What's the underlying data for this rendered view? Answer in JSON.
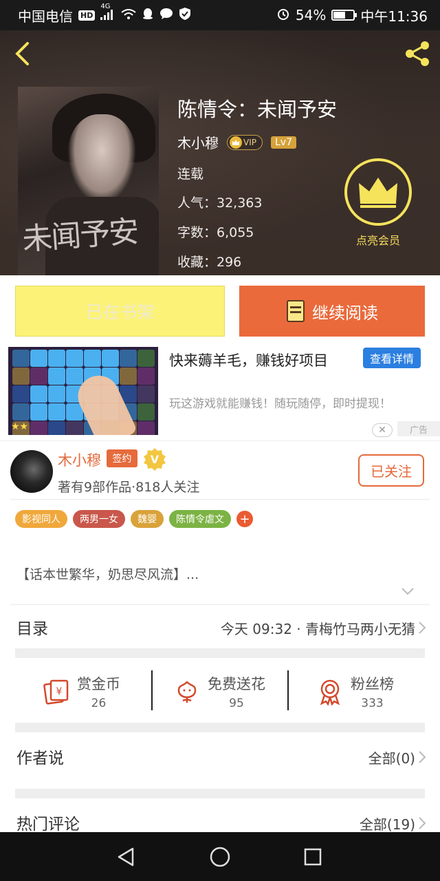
{
  "status_bar": {
    "carrier": "中国电信",
    "hd": "HD",
    "network": "4G",
    "battery_text": "54%",
    "battery_level": 0.54,
    "time": "中午11:36"
  },
  "book": {
    "title": "陈情令：未闻予安",
    "cover_title": "未闻予安",
    "author": "木小穆",
    "vip_label": "VIP",
    "level": "Lv7",
    "status": "连载",
    "popularity": "人气：32,363",
    "word_count": "字数：6,055",
    "favorites": "收藏：296",
    "vip_member_label": "点亮会员"
  },
  "actions": {
    "shelf_label": "已在书架",
    "read_label": "继续阅读"
  },
  "ad": {
    "title": "快来薅羊毛，赚钱好项目",
    "detail_button": "查看详情",
    "description": "玩这游戏就能赚钱！随玩随停，即时提现！",
    "tag": "广告"
  },
  "author_card": {
    "name": "木小穆",
    "sign_badge": "签约",
    "v_badge": "V",
    "subtitle": "著有9部作品·818人关注",
    "follow_button": "已关注"
  },
  "tags": [
    {
      "label": "影视同人",
      "color": "#f0a83c"
    },
    {
      "label": "两男一女",
      "color": "#c9574b"
    },
    {
      "label": "魏婴",
      "color": "#d9a23a"
    },
    {
      "label": "陈情令虐文",
      "color": "#7cb344"
    }
  ],
  "intro": "【话本世繁华，奶思尽风流】...",
  "catalog": {
    "title": "目录",
    "latest": "今天 09:32 · 青梅竹马两小无猜"
  },
  "stats": [
    {
      "label": "赏金币",
      "value": "26",
      "icon": "reward-coin-icon"
    },
    {
      "label": "免费送花",
      "value": "95",
      "icon": "flower-icon"
    },
    {
      "label": "粉丝榜",
      "value": "333",
      "icon": "medal-icon"
    }
  ],
  "author_says": {
    "title": "作者说",
    "right": "全部(0)"
  },
  "hot_comments": {
    "title": "热门评论",
    "right": "全部(19)"
  },
  "colors": {
    "accent": "#ea6a3c",
    "shelf": "#fbf277",
    "vip_gold": "#f5e35c"
  }
}
